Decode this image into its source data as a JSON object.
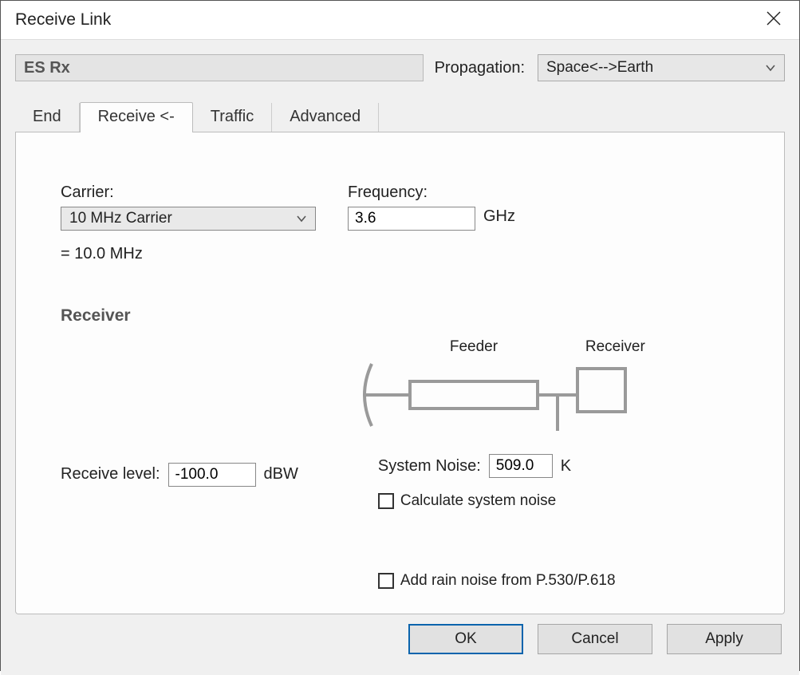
{
  "window": {
    "title": "Receive Link"
  },
  "header": {
    "name": "ES Rx",
    "propagation_label": "Propagation:",
    "propagation_value": "Space<-->Earth"
  },
  "tabs": [
    {
      "label": "End"
    },
    {
      "label": "Receive <-"
    },
    {
      "label": "Traffic"
    },
    {
      "label": "Advanced"
    }
  ],
  "carrier": {
    "label": "Carrier:",
    "value": "10 MHz Carrier",
    "equals": "= 10.0 MHz"
  },
  "frequency": {
    "label": "Frequency:",
    "value": "3.6",
    "unit": "GHz"
  },
  "receiver": {
    "heading": "Receiver",
    "level_label": "Receive level:",
    "level_value": "-100.0",
    "level_unit": "dBW",
    "diagram": {
      "feeder_label": "Feeder",
      "receiver_label": "Receiver"
    },
    "system_noise": {
      "label": "System Noise:",
      "value": "509.0",
      "unit": "K"
    },
    "calc_label": "Calculate system noise",
    "rain_label": "Add rain noise from P.530/P.618"
  },
  "buttons": {
    "ok": "OK",
    "cancel": "Cancel",
    "apply": "Apply"
  }
}
